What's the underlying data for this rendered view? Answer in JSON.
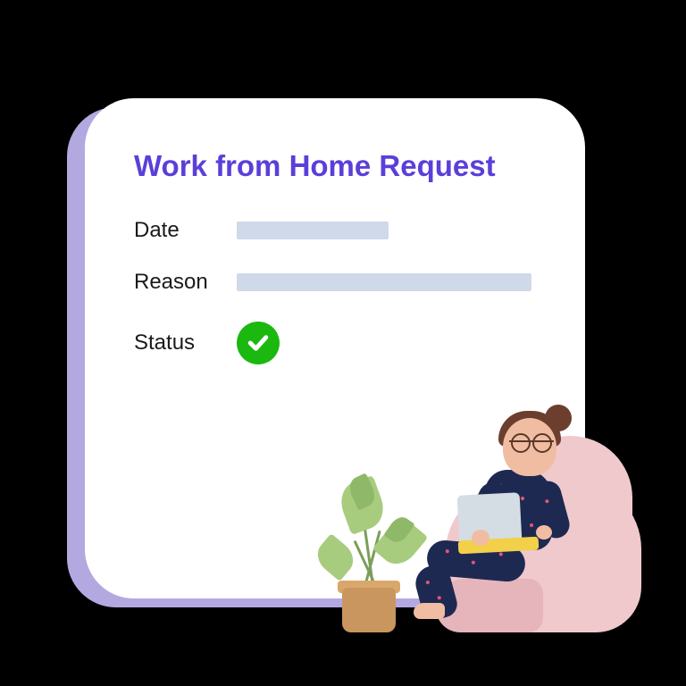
{
  "card": {
    "title": "Work from Home Request",
    "fields": {
      "date_label": "Date",
      "reason_label": "Reason",
      "status_label": "Status"
    },
    "status": "approved"
  }
}
